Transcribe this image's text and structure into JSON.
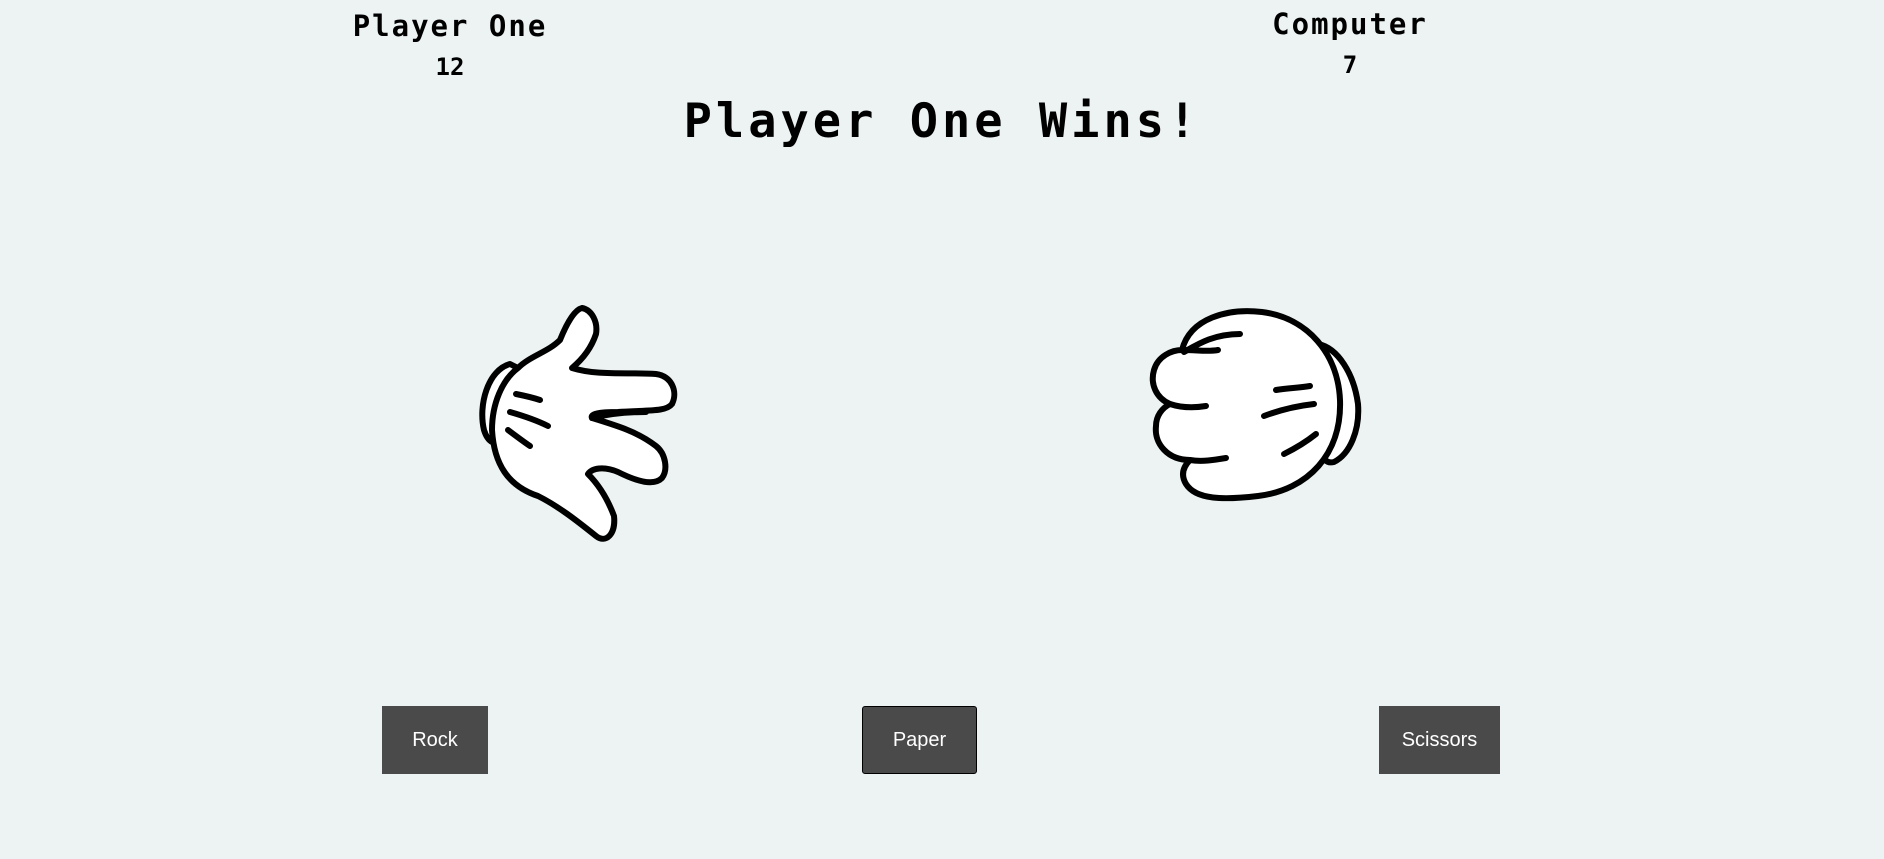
{
  "scoreboard": {
    "player": {
      "name": "Player One",
      "score": "12"
    },
    "computer": {
      "name": "Computer",
      "score": "7"
    }
  },
  "result": "Player One Wins!",
  "hands": {
    "player": "scissors-hand-icon",
    "computer": "rock-fist-icon"
  },
  "buttons": {
    "rock": "Rock",
    "paper": "Paper",
    "scissors": "Scissors"
  },
  "colors": {
    "background": "#edf3f3",
    "button": "#4a4a4a",
    "button_text": "#ffffff"
  }
}
